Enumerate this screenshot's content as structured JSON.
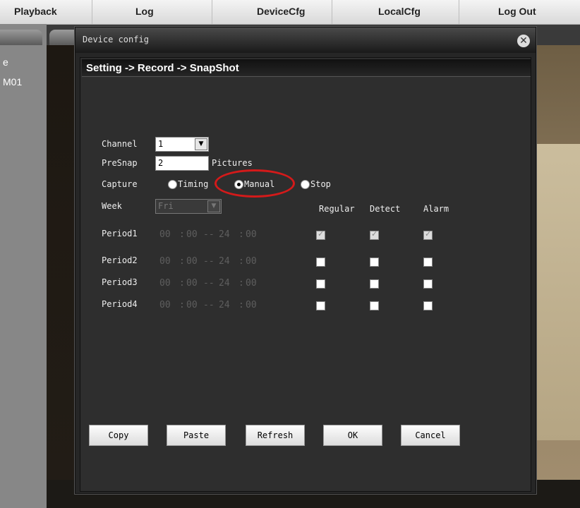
{
  "topnav": {
    "items": [
      "Playback",
      "Log",
      "DeviceCfg",
      "LocalCfg",
      "Log Out"
    ]
  },
  "leftpanel": {
    "items": [
      "e",
      "M01"
    ]
  },
  "dialog": {
    "title": "Device config",
    "path": "Setting -> Record -> SnapShot"
  },
  "form": {
    "channel_label": "Channel",
    "channel_value": "1",
    "presnap_label": "PreSnap",
    "presnap_value": "2",
    "presnap_unit": "Pictures",
    "capture_label": "Capture",
    "capture_options": [
      "Timing",
      "Manual",
      "Stop"
    ],
    "capture_selected": "Manual",
    "week_label": "Week",
    "week_value": "Fri",
    "columns": [
      "Regular",
      "Detect",
      "Alarm"
    ],
    "periods": [
      {
        "label": "Period1",
        "start_h": "00",
        "start_m": "00",
        "end_h": "24",
        "end_m": "00",
        "regular": true,
        "detect": true,
        "alarm": true
      },
      {
        "label": "Period2",
        "start_h": "00",
        "start_m": "00",
        "end_h": "24",
        "end_m": "00",
        "regular": false,
        "detect": false,
        "alarm": false
      },
      {
        "label": "Period3",
        "start_h": "00",
        "start_m": "00",
        "end_h": "24",
        "end_m": "00",
        "regular": false,
        "detect": false,
        "alarm": false
      },
      {
        "label": "Period4",
        "start_h": "00",
        "start_m": "00",
        "end_h": "24",
        "end_m": "00",
        "regular": false,
        "detect": false,
        "alarm": false
      }
    ]
  },
  "buttons": {
    "copy": "Copy",
    "paste": "Paste",
    "refresh": "Refresh",
    "ok": "OK",
    "cancel": "Cancel"
  },
  "colors": {
    "highlight": "#d41a1a",
    "dialog_bg": "#2e2e2e"
  }
}
